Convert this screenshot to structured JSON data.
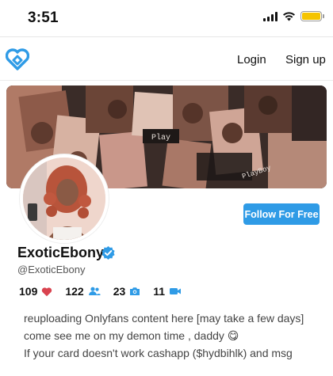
{
  "status_bar": {
    "time": "3:51",
    "battery_color": "#f5c400"
  },
  "nav": {
    "login_label": "Login",
    "signup_label": "Sign up",
    "logo_color": "#2f9be6"
  },
  "banner": {
    "tags": [
      "Play",
      "PlayBoy"
    ]
  },
  "profile": {
    "display_name": "ExoticEbony",
    "handle": "@ExoticEbony",
    "follow_label": "Follow For Free",
    "follow_color": "#2f9be6",
    "verified": true,
    "stats": [
      {
        "value": "109",
        "icon": "heart-icon"
      },
      {
        "value": "122",
        "icon": "users-icon"
      },
      {
        "value": "23",
        "icon": "camera-icon"
      },
      {
        "value": "11",
        "icon": "video-icon"
      }
    ],
    "bio_lines": [
      "reuploading Onlyfans content here  [may take a few days]",
      "come see me on my demon time , daddy 😋",
      "If your card doesn't work cashapp ($hydbihlk) and msg"
    ]
  }
}
